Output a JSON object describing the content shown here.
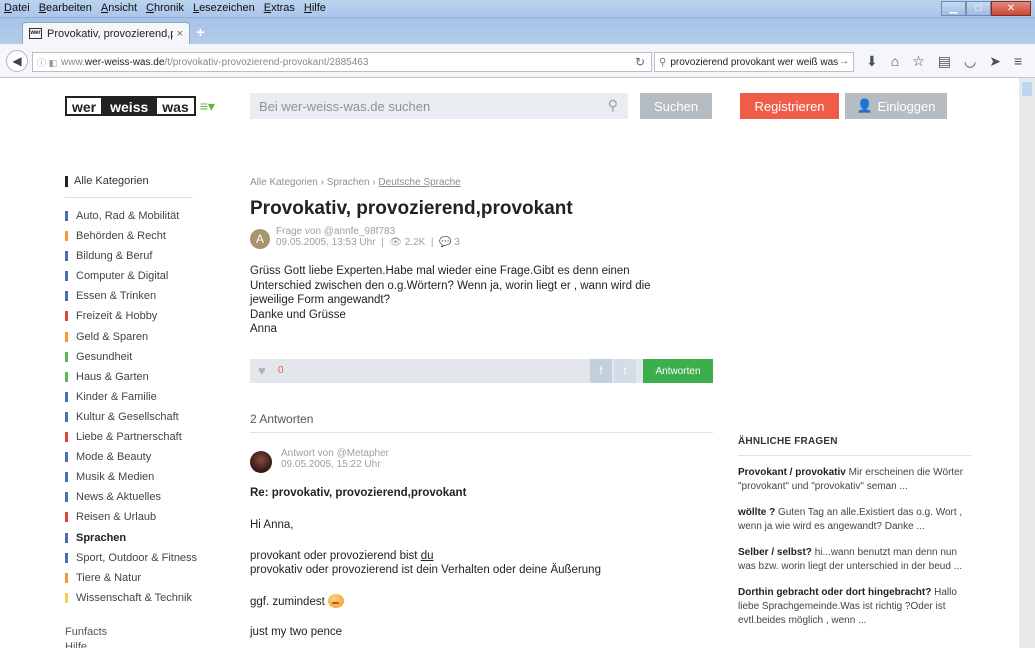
{
  "menubar": {
    "items": [
      "Datei",
      "Bearbeiten",
      "Ansicht",
      "Chronik",
      "Lesezeichen",
      "Extras",
      "Hilfe"
    ]
  },
  "tab": {
    "favicon_text": "wer",
    "title": "Provokativ, provozierend,p...",
    "close": "×",
    "new_tab": "+"
  },
  "url": {
    "prefix": "www.",
    "domain": "wer-weiss-was.de",
    "path": "/t/provokativ-provozierend-provokant/2885463"
  },
  "browser_search": {
    "query": "provozierend provokant wer weiß was"
  },
  "site_header": {
    "logo": [
      "wer",
      "weiss",
      "was"
    ],
    "search_placeholder": "Bei wer-weiss-was.de suchen",
    "search_button": "Suchen",
    "register_button": "Registrieren",
    "login_button": "Einloggen"
  },
  "sidebar": {
    "all_label": "Alle Kategorien",
    "categories": [
      {
        "label": "Auto, Rad & Mobilität",
        "color": "#4a6fb5"
      },
      {
        "label": "Behörden & Recht",
        "color": "#f39a2e"
      },
      {
        "label": "Bildung & Beruf",
        "color": "#4a6fb5"
      },
      {
        "label": "Computer & Digital",
        "color": "#4a6fb5"
      },
      {
        "label": "Essen & Trinken",
        "color": "#4a6fb5"
      },
      {
        "label": "Freizeit & Hobby",
        "color": "#e0443a"
      },
      {
        "label": "Geld & Sparen",
        "color": "#f39a2e"
      },
      {
        "label": "Gesundheit",
        "color": "#5cb85c"
      },
      {
        "label": "Haus & Garten",
        "color": "#5cb85c"
      },
      {
        "label": "Kinder & Familie",
        "color": "#4a6fb5"
      },
      {
        "label": "Kultur & Gesellschaft",
        "color": "#4a6fb5"
      },
      {
        "label": "Liebe & Partnerschaft",
        "color": "#e0443a"
      },
      {
        "label": "Mode & Beauty",
        "color": "#4a6fb5"
      },
      {
        "label": "Musik & Medien",
        "color": "#4a6fb5"
      },
      {
        "label": "News & Aktuelles",
        "color": "#4a6fb5"
      },
      {
        "label": "Reisen & Urlaub",
        "color": "#e0443a"
      },
      {
        "label": "Sprachen",
        "color": "#4a6fb5",
        "active": true
      },
      {
        "label": "Sport, Outdoor & Fitness",
        "color": "#4a6fb5"
      },
      {
        "label": "Tiere & Natur",
        "color": "#f39a2e"
      },
      {
        "label": "Wissenschaft & Technik",
        "color": "#f5d04a"
      }
    ],
    "extra": [
      "Funfacts",
      "Hilfe"
    ]
  },
  "question": {
    "breadcrumb": [
      "Alle Kategorien",
      "Sprachen",
      "Deutsche Sprache"
    ],
    "breadcrumb_sep": " › ",
    "title": "Provokativ, provozierend,provokant",
    "avatar_letter": "A",
    "asker": "Frage von @annfe_98f783",
    "date": "09.05.2005, 13:53 Uhr",
    "views": "2.2K",
    "comments": "3",
    "body": "Grüss Gott liebe Experten.Habe mal wieder eine Frage.Gibt es denn einen\nUnterschied zwischen den o.g.Wörtern? Wenn ja, worin liegt er , wann wird die\njeweilige Form angewandt?\nDanke und Grüsse\nAnna",
    "likes": "0",
    "answer_button": "Antworten"
  },
  "answers": {
    "heading": "2 Antworten",
    "items": [
      {
        "author": "Antwort von @Metapher",
        "date": "09.05.2005, 15:22 Uhr",
        "title": "Re: provokativ, provozierend,provokant",
        "greeting": "Hi Anna,",
        "line1_a": "provokant oder provozierend bist ",
        "line1_b": "du",
        "line2": "provokativ oder provozierend ist dein Verhalten oder deine Äußerung",
        "line3": "ggf. zumindest",
        "line4": "just my two pence"
      }
    ]
  },
  "similar": {
    "heading": "ÄHNLICHE FRAGEN",
    "items": [
      {
        "title": "Provokant / provokativ",
        "snippet": " Mir erscheinen die Wörter \"provokant\" und \"provokativ\" seman ..."
      },
      {
        "title": "wöllte ?",
        "snippet": " Guten Tag an alle.Existiert das o.g. Wort , wenn ja wie wird es angewandt? Danke ..."
      },
      {
        "title": "Selber / selbst?",
        "snippet": " hi...wann benutzt man denn nun was bzw. worin liegt der unterschied in der beud ..."
      },
      {
        "title": "Dorthin gebracht oder dort hingebracht?",
        "snippet": " Hallo liebe Sprachgemeinde.Was ist richtig ?Oder ist evtl.beides möglich , wenn ..."
      }
    ]
  }
}
